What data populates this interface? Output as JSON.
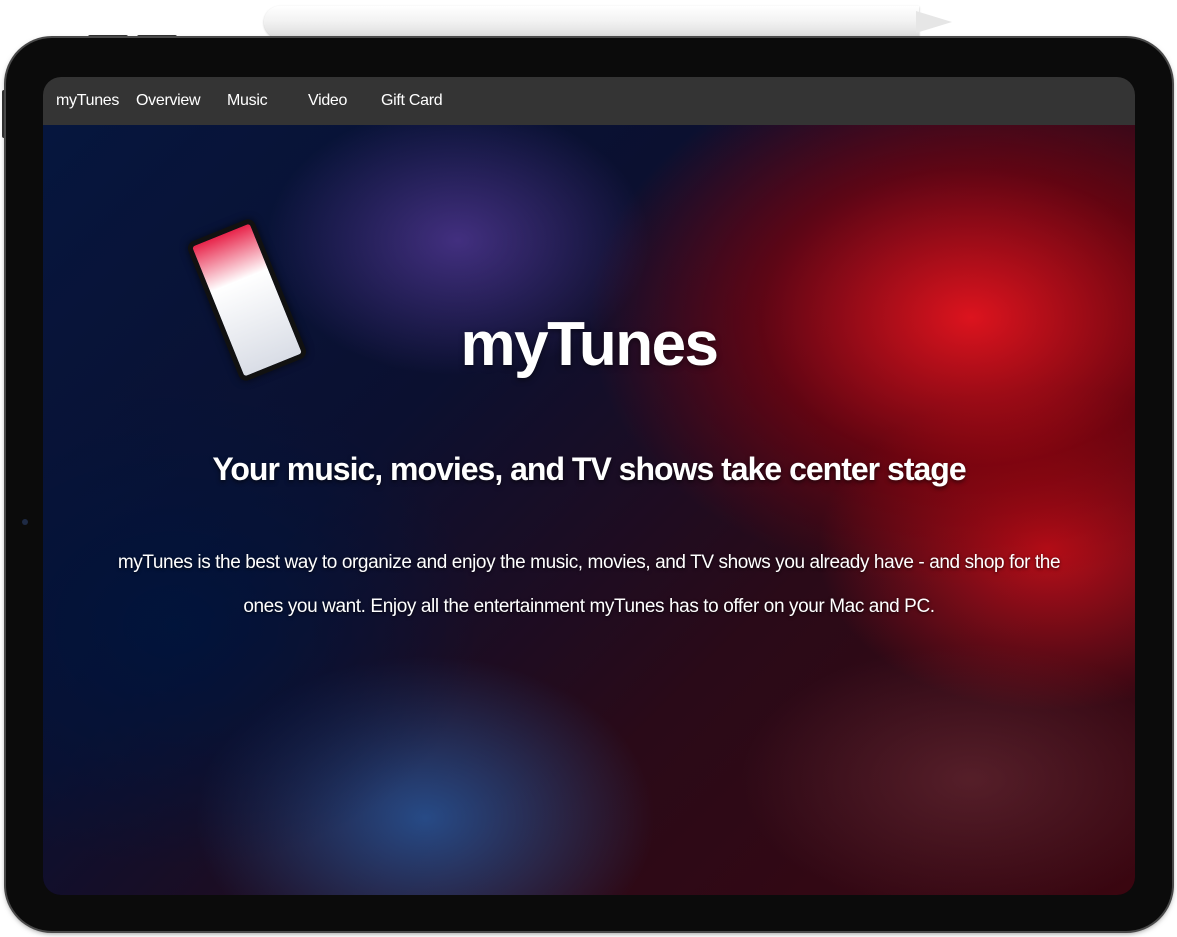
{
  "nav": {
    "brand": "myTunes",
    "items": [
      {
        "label": "Overview"
      },
      {
        "label": "Music"
      },
      {
        "label": "Video"
      },
      {
        "label": "Gift Card"
      }
    ]
  },
  "hero": {
    "title": "myTunes",
    "subtitle": "Your music, movies, and TV shows take center stage",
    "description": "myTunes is the best way to organize and enjoy the music, movies, and TV shows you already have - and shop for the ones you want. Enjoy all the entertainment myTunes has to offer on your Mac and PC."
  },
  "colors": {
    "navbar_bg": "#343434",
    "text": "#ffffff",
    "accent_red": "#e6141e",
    "accent_blue": "#06163e"
  }
}
